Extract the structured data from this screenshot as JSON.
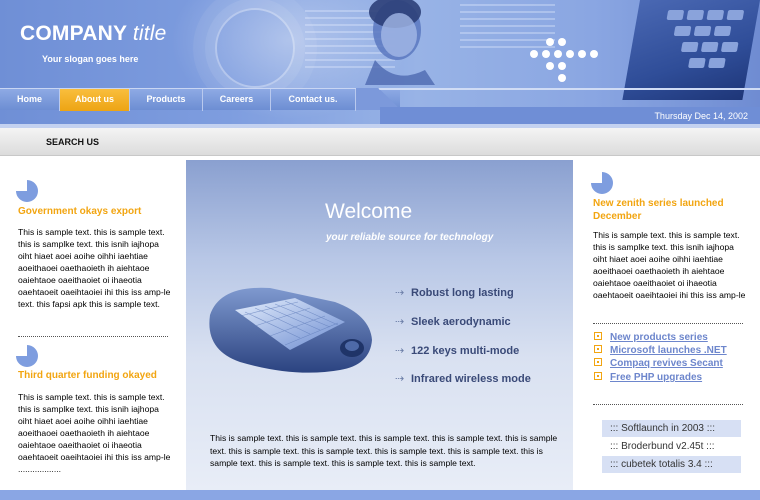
{
  "header": {
    "company": "COMPANY",
    "company_suffix": "title",
    "slogan": "Your slogan goes here",
    "date": "Thursday Dec 14, 2002"
  },
  "nav": {
    "items": [
      {
        "label": "Home",
        "active": false
      },
      {
        "label": "About us",
        "active": true
      },
      {
        "label": "Products",
        "active": false
      },
      {
        "label": "Careers",
        "active": false
      },
      {
        "label": "Contact us.",
        "active": false
      }
    ]
  },
  "search": {
    "label": "SEARCH US"
  },
  "left": {
    "news": [
      {
        "title": "Government okays export",
        "text": "This is sample text. this is sample text. this is samplke text. this isnih iajhopa oiht hiaet aoei aoihe oihhi iaehtiae aoeithaoei oaethaoieth ih aiehtaoe oaiehtaoe oaeithaoiet oi ihaeotia oaehtaoeit oaeihtaoiei ihi this iss amp-le text. this fapsi apk this is sample text."
      },
      {
        "title": "Third quarter funding okayed",
        "text": "This is sample text. this is sample text. this is samplke text. this isnih iajhopa oiht hiaet aoei aoihe oihhi iaehtiae aoeithaoei oaethaoieth ih aiehtaoe oaiehtaoe oaeithaoiet oi ihaeotia oaehtaoeit oaeihtaoiei ihi this iss amp-le .................."
      }
    ]
  },
  "center": {
    "welcome": "Welcome",
    "tagline": "your reliable source for technology",
    "features": [
      "Robust long lasting",
      "Sleek aerodynamic",
      "122 keys multi-mode",
      "Infrared wireless mode"
    ],
    "paragraph": "This is sample text. this is sample text. this is sample text. this is sample text. this is sample text. this is sample text. this is sample text. this is sample text.  this is sample text. this is sample text. this is sample text. this is sample text. this is sample text."
  },
  "right": {
    "news_title": "New zenith series launched December",
    "news_text": "This is sample text. this is sample text. this is samplke text. this isnih iajhopa oiht hiaet aoei aoihe oihhi iaehtiae aoeithaoei oaethaoieth ih aiehtaoe oaiehtaoe oaeithaoiet oi ihaeotia oaehtaoeit oaeihtaoiei ihi this iss amp-le",
    "links": [
      "New products series",
      "Microsoft launches .NET",
      "Compaq revives Secant",
      "Free PHP upgrades"
    ],
    "releases": [
      "::: Softlaunch in 2003 :::",
      "::: Broderbund v2.45t :::",
      "::: cubetek totalis 3.4 :::"
    ]
  },
  "colors": {
    "accent_orange": "#f2a511",
    "header_blue": "#7e9ddf",
    "link_blue": "#6d86cc"
  }
}
